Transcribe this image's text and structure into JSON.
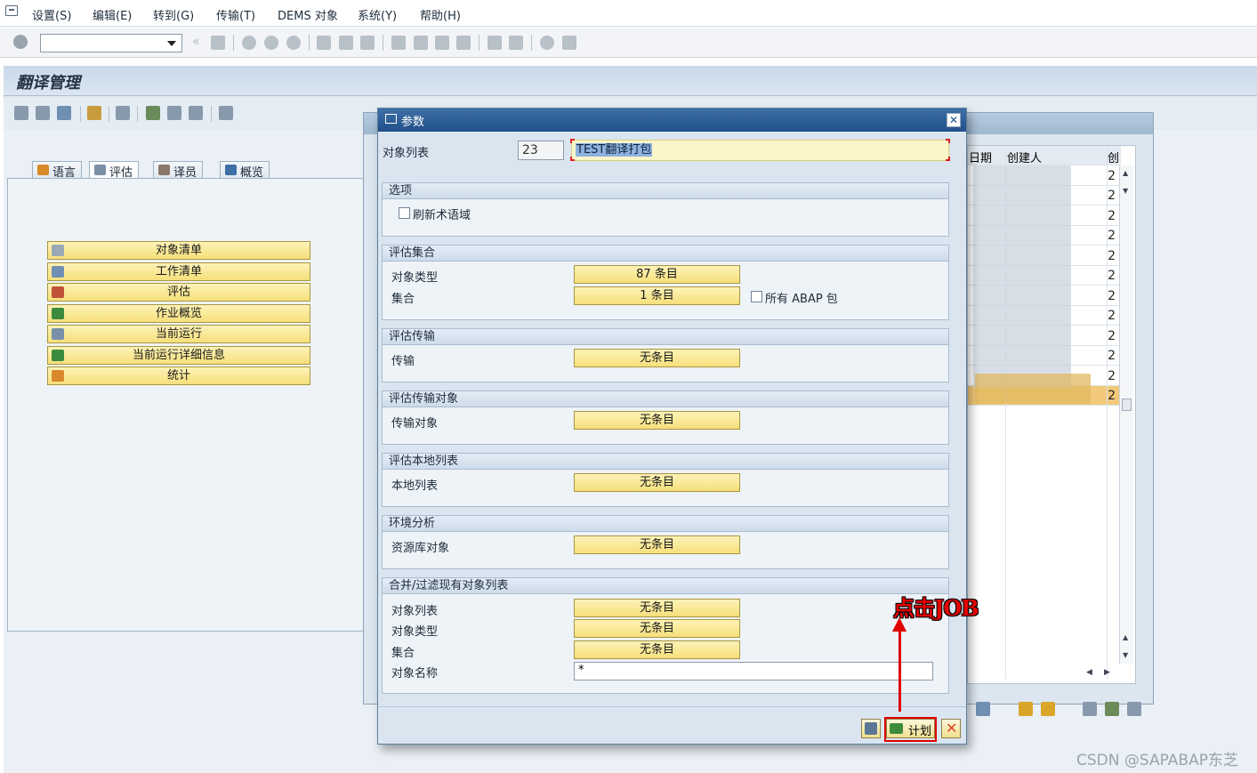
{
  "menubar": {
    "items": [
      "设置(S)",
      "编辑(E)",
      "转到(G)",
      "传输(T)",
      "DEMS 对象",
      "系统(Y)",
      "帮助(H)"
    ]
  },
  "screen": {
    "title": "翻译管理"
  },
  "tabs": [
    {
      "label": "语言",
      "active": false
    },
    {
      "label": "评估",
      "active": true
    },
    {
      "label": "译员",
      "active": false
    },
    {
      "label": "概览",
      "active": false
    }
  ],
  "left_buttons": [
    {
      "label": "对象清单",
      "icon": "document-icon"
    },
    {
      "label": "工作清单",
      "icon": "tools-icon"
    },
    {
      "label": "评估",
      "icon": "list-settings-icon"
    },
    {
      "label": "作业概览",
      "icon": "job-icon"
    },
    {
      "label": "当前运行",
      "icon": "clock-icon"
    },
    {
      "label": "当前运行详细信息",
      "icon": "job-detail-icon"
    },
    {
      "label": "统计",
      "icon": "statistics-icon"
    }
  ],
  "background_table": {
    "headers": [
      "日期",
      "创建人",
      "创"
    ],
    "col_values": [
      "2",
      "2",
      "2",
      "2",
      "2",
      "2",
      "2",
      "2",
      "2",
      "2",
      "2",
      "2"
    ]
  },
  "dialog": {
    "title": "参数",
    "object_list_label": "对象列表",
    "object_list_number": "23",
    "object_list_name": "TEST翻译打包",
    "groups": {
      "options": {
        "title": "选项",
        "refresh_terminology_label": "刷新术语域",
        "refresh_terminology_checked": false
      },
      "eval_set": {
        "title": "评估集合",
        "object_type_label": "对象类型",
        "object_type_value": "87 条目",
        "collection_label": "集合",
        "collection_value": "1 条目",
        "all_abap_label": "所有 ABAP 包",
        "all_abap_checked": false
      },
      "eval_transport": {
        "title": "评估传输",
        "transport_label": "传输",
        "transport_value": "无条目"
      },
      "eval_transport_object": {
        "title": "评估传输对象",
        "transport_object_label": "传输对象",
        "transport_object_value": "无条目"
      },
      "eval_local_list": {
        "title": "评估本地列表",
        "local_list_label": "本地列表",
        "local_list_value": "无条目"
      },
      "env_analysis": {
        "title": "环境分析",
        "repo_object_label": "资源库对象",
        "repo_object_value": "无条目"
      },
      "merge_filter": {
        "title": "合并/过滤现有对象列表",
        "object_list_label": "对象列表",
        "object_list_value": "无条目",
        "object_type_label": "对象类型",
        "object_type_value": "无条目",
        "collection_label": "集合",
        "collection_value": "无条目",
        "object_name_label": "对象名称",
        "object_name_value": "*"
      }
    },
    "footer": {
      "schedule_label": "计划"
    }
  },
  "annotation": {
    "text": "点击JOB",
    "color": "#e50000"
  },
  "watermark": "CSDN @SAPABAP东芝"
}
